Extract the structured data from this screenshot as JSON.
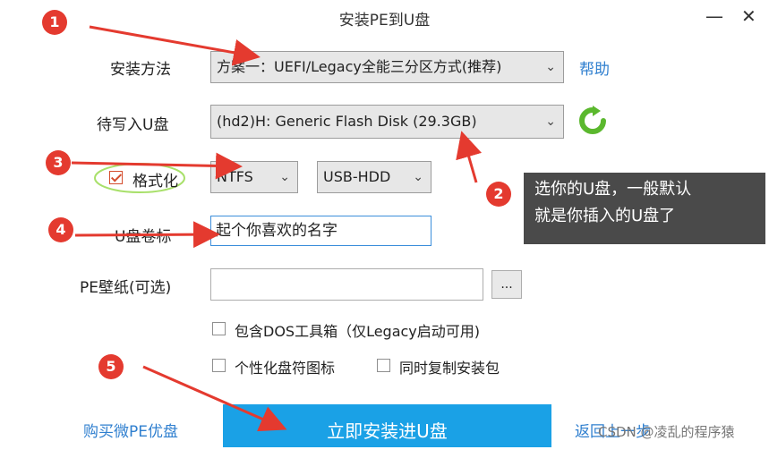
{
  "window": {
    "title": "安装PE到U盘",
    "minimize": "—",
    "close": "✕"
  },
  "form": {
    "install_method_label": "安装方法",
    "install_method_value": "方案一：UEFI/Legacy全能三分区方式(推荐)",
    "help_link": "帮助",
    "target_disk_label": "待写入U盘",
    "target_disk_value": "(hd2)H: Generic Flash Disk (29.3GB)",
    "format_label": "格式化",
    "format_checked": true,
    "filesystem_value": "NTFS",
    "mode_value": "USB-HDD",
    "volume_label": "U盘卷标",
    "volume_value": "起个你喜欢的名字",
    "wallpaper_label": "PE壁纸(可选)",
    "wallpaper_value": "",
    "browse_label": "...",
    "dos_tools_label": "包含DOS工具箱（仅Legacy启动可用)",
    "custom_icon_label": "个性化盘符图标",
    "copy_installer_label": "同时复制安装包"
  },
  "footer": {
    "buy_link": "购买微PE优盘",
    "install_button": "立即安装进U盘",
    "back_link": "返回上一步"
  },
  "annotations": {
    "badge_1": "1",
    "badge_2": "2",
    "badge_3": "3",
    "badge_4": "4",
    "badge_5": "5",
    "tooltip_line1": "选你的U盘，一般默认",
    "tooltip_line2": "就是你插入的U盘了",
    "watermark": "CSDN @凌乱的程序猿"
  },
  "colors": {
    "accent": "#1aa1e6",
    "link": "#2f7fcf",
    "annotation_red": "#e43a2f",
    "refresh_green": "#5bb82e"
  }
}
